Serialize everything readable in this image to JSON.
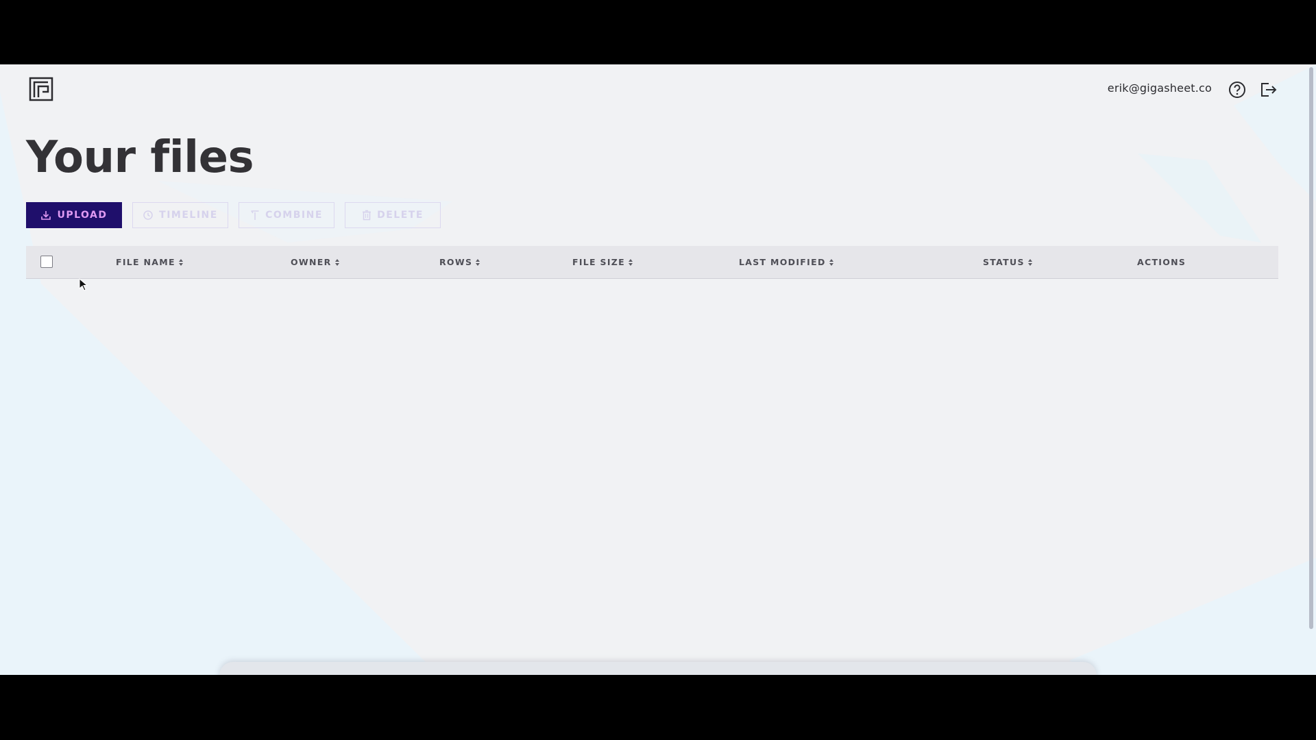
{
  "header": {
    "logo_icon": "gigasheet-logo-icon",
    "user_email": "erik@gigasheet.co",
    "help_icon": "help-circle-icon",
    "logout_icon": "logout-icon"
  },
  "page": {
    "title": "Your files"
  },
  "toolbar": {
    "upload_label": "UPLOAD",
    "timeline_label": "TIMELINE",
    "combine_label": "COMBINE",
    "delete_label": "DELETE"
  },
  "table": {
    "columns": [
      {
        "label": "FILE NAME",
        "sortable": true
      },
      {
        "label": "OWNER",
        "sortable": true
      },
      {
        "label": "ROWS",
        "sortable": true
      },
      {
        "label": "FILE SIZE",
        "sortable": true
      },
      {
        "label": "LAST MODIFIED",
        "sortable": true
      },
      {
        "label": "STATUS",
        "sortable": true
      },
      {
        "label": "ACTIONS",
        "sortable": false
      }
    ],
    "rows": []
  },
  "colors": {
    "primary": "#1f0f6b",
    "primary_text": "#e09af3",
    "disabled_border": "#dcd8ef",
    "background": "#f1f2f4",
    "title": "#333236"
  }
}
